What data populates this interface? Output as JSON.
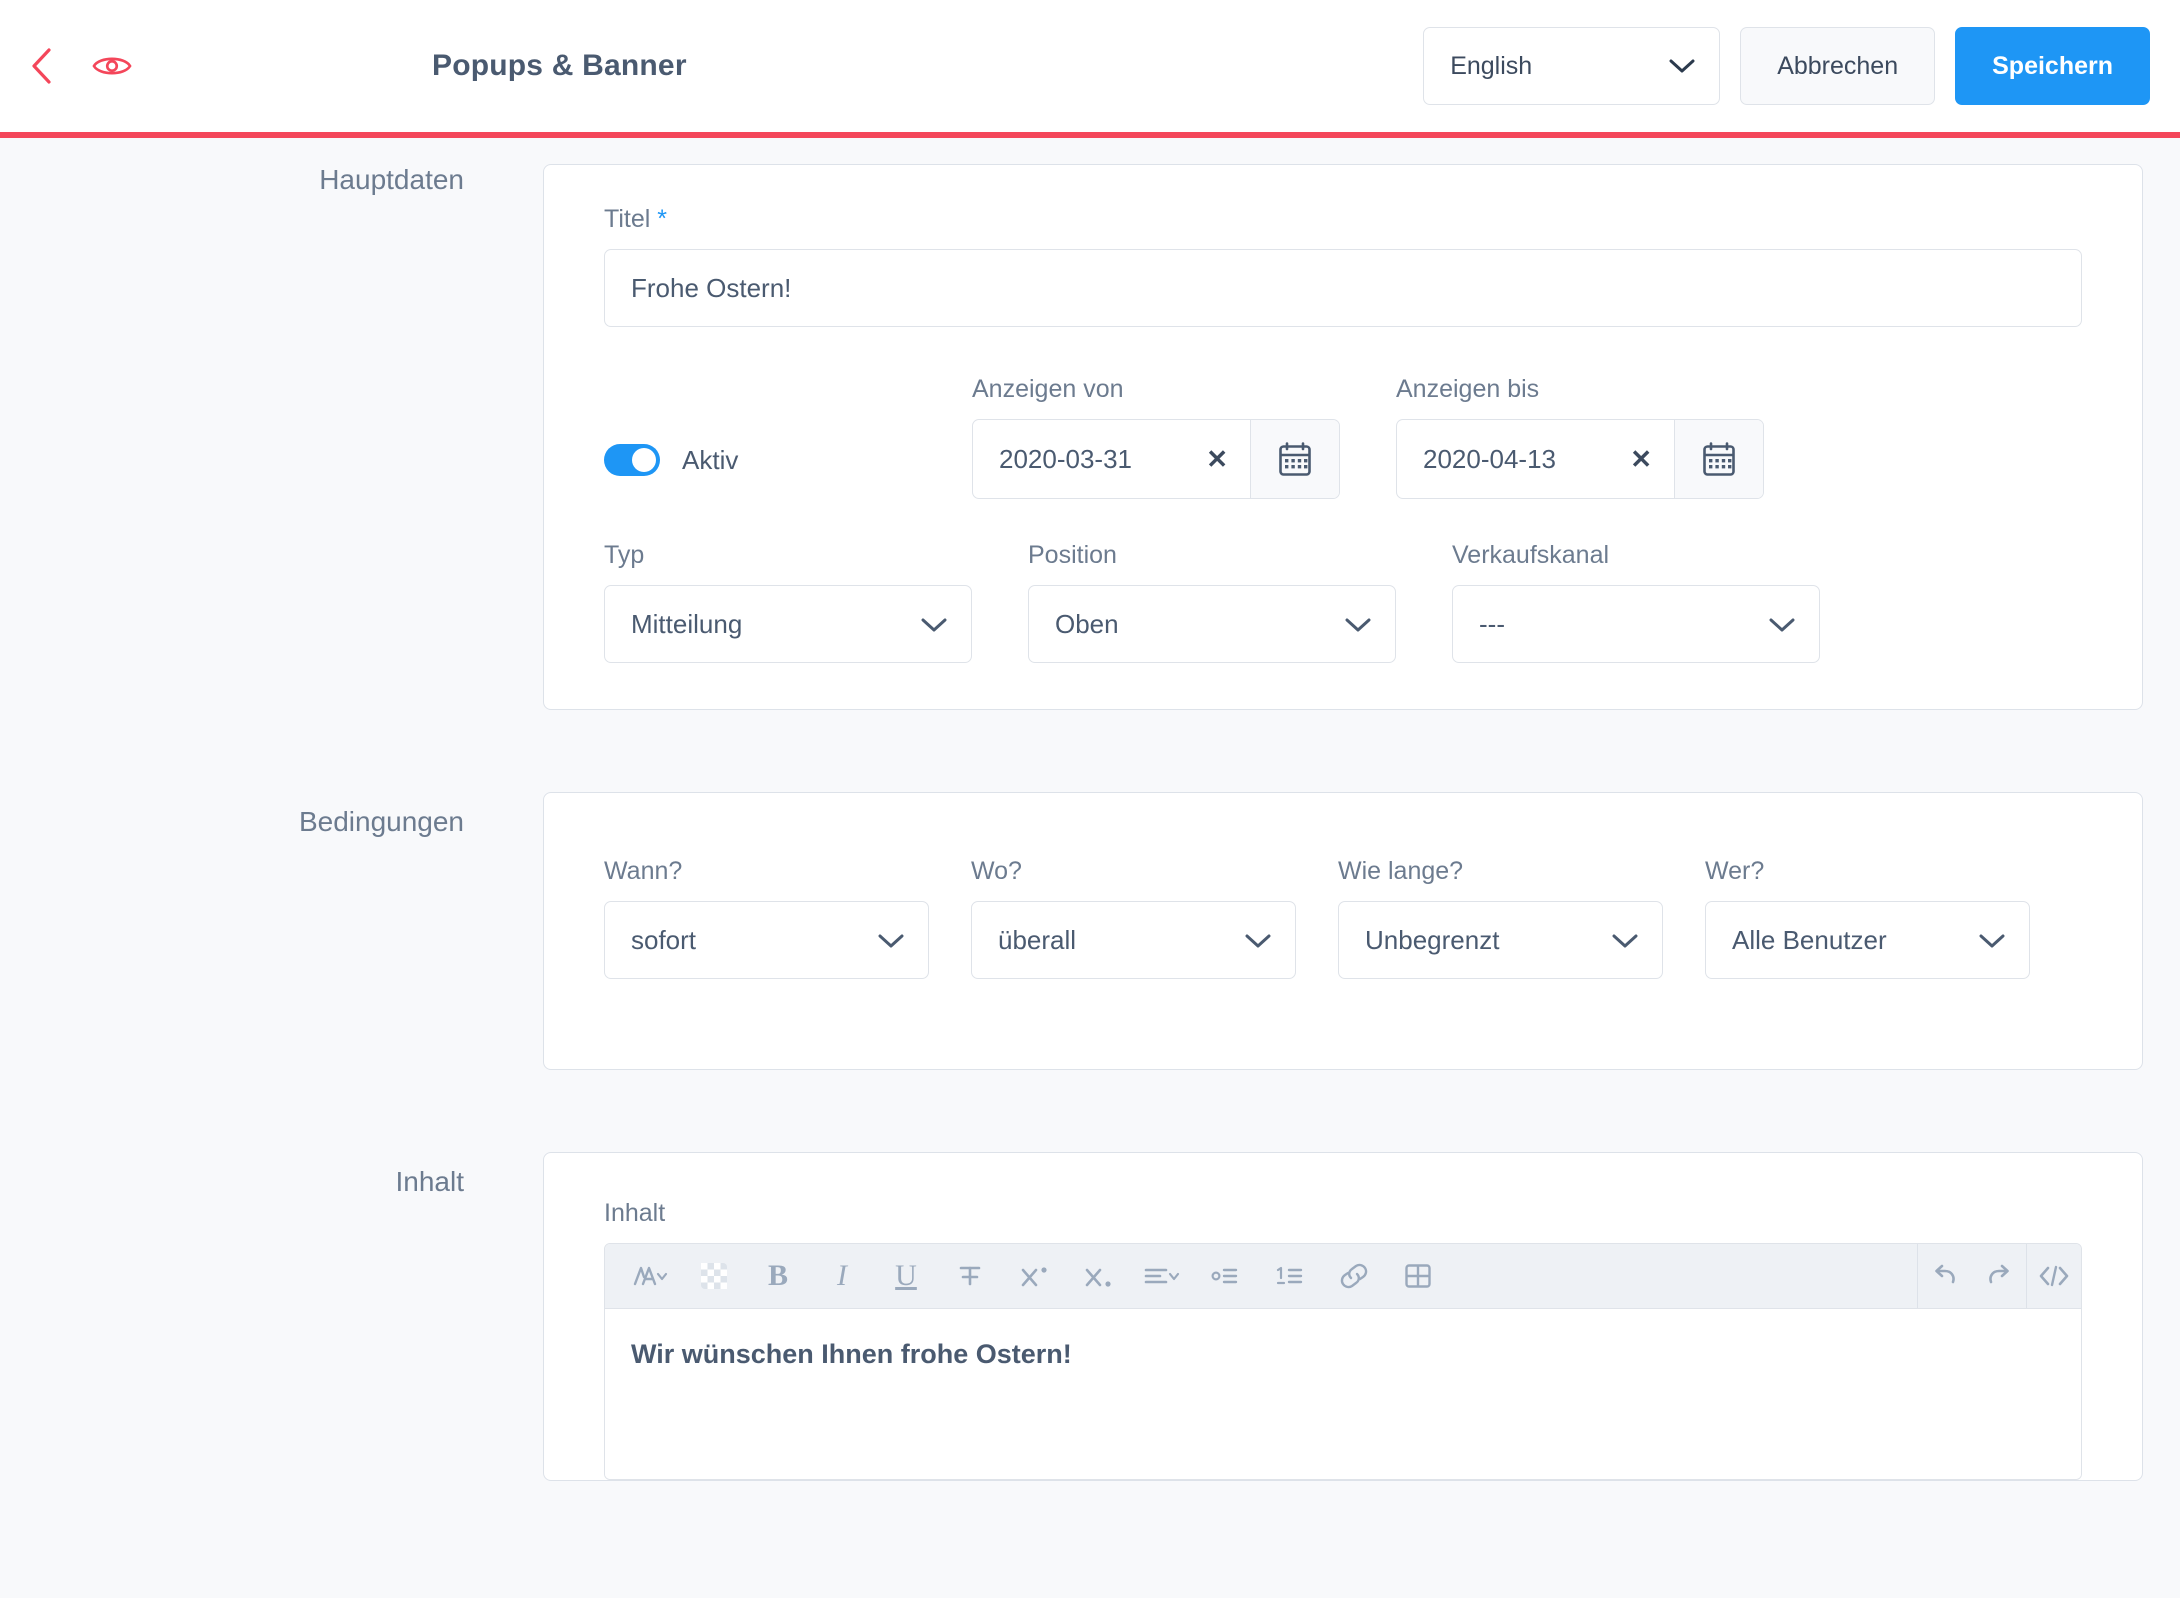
{
  "header": {
    "back_icon": "chevron-left-icon",
    "preview_icon": "eye-icon",
    "title": "Popups & Banner",
    "language_value": "English",
    "cancel_label": "Abbrechen",
    "save_label": "Speichern",
    "accent_red": "#f4465a",
    "accent_blue": "#1e96f5"
  },
  "sections": {
    "main": {
      "label": "Hauptdaten",
      "title_field": {
        "label": "Titel",
        "required_marker": "*",
        "value": "Frohe Ostern!"
      },
      "active_toggle": {
        "label": "Aktiv",
        "state": "on"
      },
      "date_from": {
        "label": "Anzeigen von",
        "value": "2020-03-31",
        "clear_icon": "close-icon",
        "calendar_icon": "calendar-icon"
      },
      "date_to": {
        "label": "Anzeigen bis",
        "value": "2020-04-13",
        "clear_icon": "close-icon",
        "calendar_icon": "calendar-icon"
      },
      "type": {
        "label": "Typ",
        "value": "Mitteilung"
      },
      "position": {
        "label": "Position",
        "value": "Oben"
      },
      "sales_channel": {
        "label": "Verkaufskanal",
        "value": "---"
      }
    },
    "conditions": {
      "label": "Bedingungen",
      "when": {
        "label": "Wann?",
        "value": "sofort"
      },
      "where": {
        "label": "Wo?",
        "value": "überall"
      },
      "how_long": {
        "label": "Wie lange?",
        "value": "Unbegrenzt"
      },
      "who": {
        "label": "Wer?",
        "value": "Alle Benutzer"
      }
    },
    "content": {
      "label": "Inhalt",
      "field_label": "Inhalt",
      "body_text": "Wir wünschen Ihnen frohe Ostern!",
      "toolbar": [
        {
          "name": "font-style-icon",
          "glyph": "A"
        },
        {
          "name": "text-color-icon",
          "glyph": ""
        },
        {
          "name": "bold-icon",
          "glyph": "B"
        },
        {
          "name": "italic-icon",
          "glyph": "I"
        },
        {
          "name": "underline-icon",
          "glyph": "U"
        },
        {
          "name": "strikethrough-icon",
          "glyph": "T"
        },
        {
          "name": "superscript-icon",
          "glyph": "X"
        },
        {
          "name": "subscript-icon",
          "glyph": "X"
        },
        {
          "name": "align-icon",
          "glyph": ""
        },
        {
          "name": "bulleted-list-icon",
          "glyph": ""
        },
        {
          "name": "numbered-list-icon",
          "glyph": ""
        },
        {
          "name": "link-icon",
          "glyph": ""
        },
        {
          "name": "table-icon",
          "glyph": ""
        },
        {
          "name": "undo-icon",
          "glyph": ""
        },
        {
          "name": "redo-icon",
          "glyph": ""
        },
        {
          "name": "source-code-icon",
          "glyph": ""
        }
      ]
    }
  }
}
